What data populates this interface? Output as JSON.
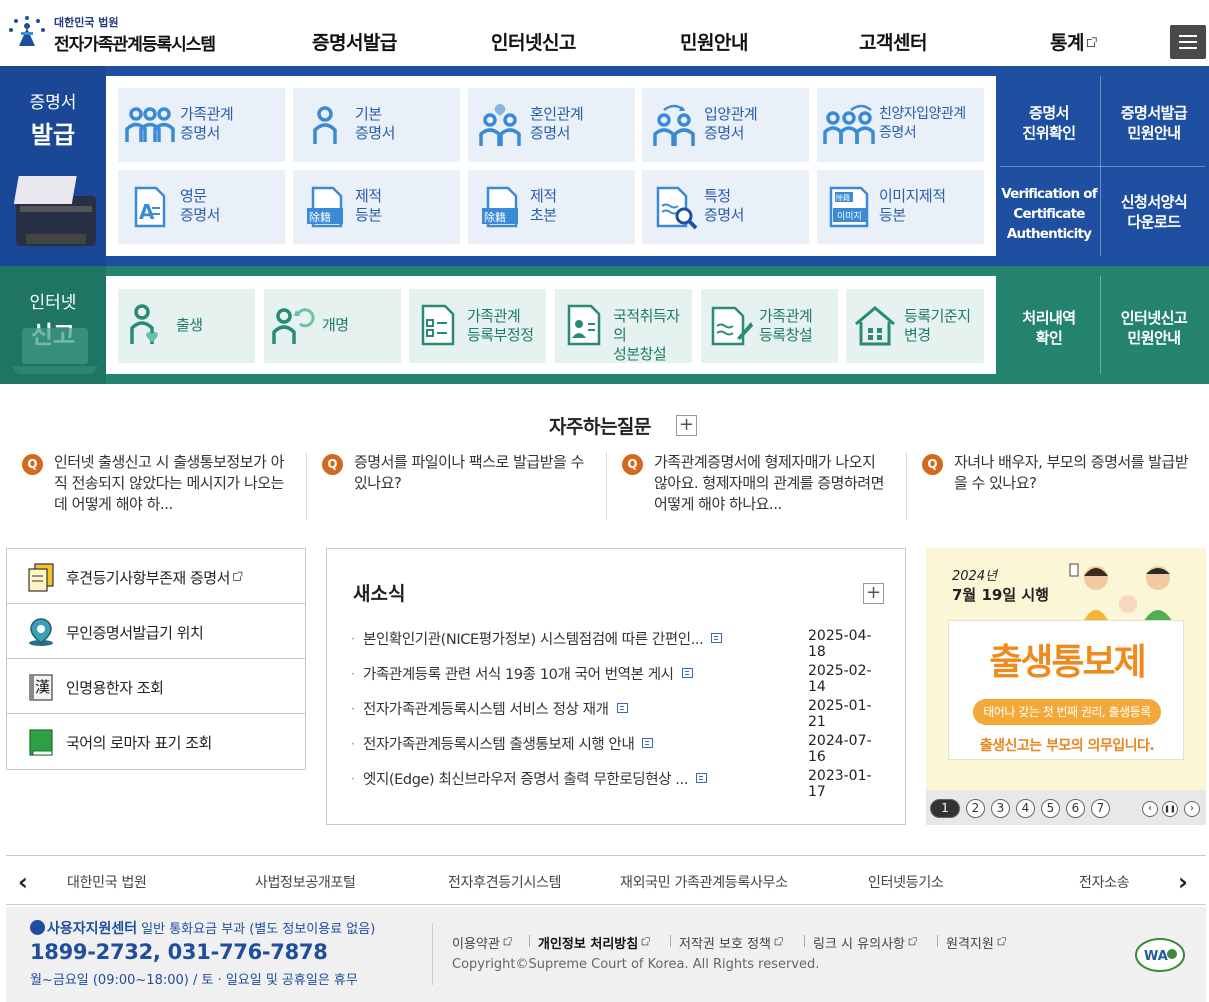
{
  "header": {
    "logo_small": "대한민국 법원",
    "logo_big": "전자가족관계등록시스템",
    "nav": [
      "증명서발급",
      "인터넷신고",
      "민원안내",
      "고객센터",
      "통계"
    ]
  },
  "issue": {
    "title_small": "증명서",
    "title_big": "발급",
    "cards": [
      {
        "l1": "가족관계",
        "l2": "증명서"
      },
      {
        "l1": "기본",
        "l2": "증명서"
      },
      {
        "l1": "혼인관계",
        "l2": "증명서"
      },
      {
        "l1": "입양관계",
        "l2": "증명서"
      },
      {
        "l1": "친양자입양관계",
        "l2": "증명서"
      },
      {
        "l1": "영문",
        "l2": "증명서"
      },
      {
        "l1": "제적",
        "l2": "등본"
      },
      {
        "l1": "제적",
        "l2": "초본"
      },
      {
        "l1": "특정",
        "l2": "증명서"
      },
      {
        "l1": "이미지제적",
        "l2": "등본"
      }
    ],
    "side": [
      {
        "l1": "증명서",
        "l2": "진위확인"
      },
      {
        "l1": "증명서발급",
        "l2": "민원안내"
      },
      {
        "l1": "Verification of",
        "l2": "Certificate",
        "l3": "Authenticity"
      },
      {
        "l1": "신청서양식",
        "l2": "다운로드"
      }
    ],
    "icon_text": {
      "jejeok": "除籍",
      "image_top": "除籍",
      "image": "이미지"
    }
  },
  "report": {
    "title_small": "인터넷",
    "title_big": "신고",
    "cards": [
      {
        "l1": "출생",
        "l2": ""
      },
      {
        "l1": "개명",
        "l2": ""
      },
      {
        "l1": "가족관계",
        "l2": "등록부정정"
      },
      {
        "l1": "국적취득자의",
        "l2": "성본창설"
      },
      {
        "l1": "가족관계",
        "l2": "등록창설"
      },
      {
        "l1": "등록기준지",
        "l2": "변경"
      }
    ],
    "side": [
      {
        "l1": "처리내역",
        "l2": "확인"
      },
      {
        "l1": "인터넷신고",
        "l2": "민원안내"
      }
    ]
  },
  "faq": {
    "title": "자주하는질문",
    "plus": "+",
    "q_mark": "Q",
    "items": [
      "인터넷 출생신고 시 출생통보정보가 아직 전송되지 않았다는 메시지가 나오는데 어떻게 해야 하...",
      "증명서를 파일이나 팩스로 발급받을 수 있나요?",
      "가족관계증명서에 형제자매가 나오지 않아요. 형제자매의 관계를 증명하려면 어떻게 해야 하나요...",
      "자녀나 배우자, 부모의 증명서를 발급받을 수 있나요?"
    ]
  },
  "quick": [
    "후견등기사항부존재 증명서",
    "무인증명서발급기 위치",
    "인명용한자 조회",
    "국어의 로마자 표기 조회"
  ],
  "quick_icon_text": "漢",
  "news": {
    "title": "새소식",
    "plus": "+",
    "items": [
      {
        "title": "본인확인기관(NICE평가정보) 시스템점검에 따른 간편인...",
        "date": "2025-04-18"
      },
      {
        "title": "가족관계등록 관련 서식 19종 10개 국어 번역본 게시",
        "date": "2025-02-14"
      },
      {
        "title": "전자가족관계등록시스템 서비스 정상 재개",
        "date": "2025-01-21"
      },
      {
        "title": "전자가족관계등록시스템 출생통보제 시행 안내",
        "date": "2024-07-16"
      },
      {
        "title": "엣지(Edge) 최신브라우저 증명서 출력 무한로딩현상 ...",
        "date": "2023-01-17"
      }
    ]
  },
  "banner": {
    "date_line1": "2024년",
    "date_line2": "7월 19일 시행",
    "main": "출생통보제",
    "pill": "태어나 갖는 첫 번째 권리, 출생등록",
    "bottom": "출생신고는 부모의 의무입니다.",
    "pages": [
      "1",
      "2",
      "3",
      "4",
      "5",
      "6",
      "7"
    ],
    "active_page": 1,
    "controls": {
      "prev": "‹",
      "pause": "❚❚",
      "next": "›"
    }
  },
  "related": {
    "prev": "‹",
    "next": "›",
    "items": [
      "대한민국 법원",
      "사법정보공개포털",
      "전자후견등기시스템",
      "재외국민 가족관계등록사무소",
      "인터넷등기소",
      "전자소송"
    ]
  },
  "footer": {
    "center_title": "사용자지원센터",
    "center_sub": "일반 통화요금 부과 (별도 정보이용료 없음)",
    "phone": "1899-2732, 031-776-7878",
    "hours": "월~금요일 (09:00~18:00) / 토 · 일요일 및 공휴일은 휴무",
    "links": [
      "이용약관",
      "개인정보 처리방침",
      "저작권 보호 정책",
      "링크 시 유의사항",
      "원격지원"
    ],
    "copyright": "Copyright©Supreme Court of Korea. All Rights reserved.",
    "wa_label": "WA"
  },
  "colors": {
    "issue_blue": "#1e4fa0",
    "report_green": "#23836f",
    "faq_q": "#d2691e",
    "banner_orange": "#f08a1c"
  }
}
